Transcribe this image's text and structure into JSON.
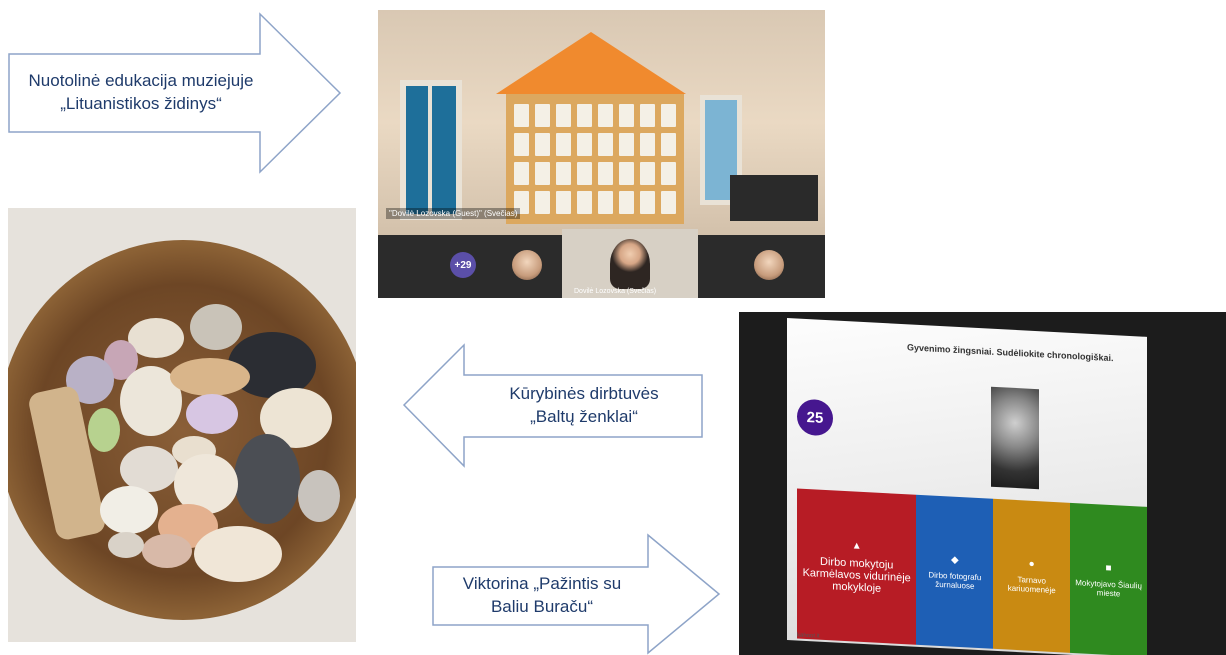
{
  "arrows": {
    "top": {
      "lines": [
        "Nuotolinė edukacija muziejuje",
        "„Lituanistikos židinys“"
      ]
    },
    "middle": {
      "lines": [
        "Kūrybinės dirbtuvės",
        "„Baltų ženklai“"
      ]
    },
    "bottom": {
      "lines": [
        "Viktorina „Pažintis su",
        "Baliu Buraču“"
      ]
    }
  },
  "video_call": {
    "speaker_name": "\"Dovilė Lozovska (Guest)\" (Svečias)",
    "participants_badge": "+29",
    "presenter_name": "Dovilė Lozovska (Svečias)"
  },
  "quiz": {
    "title": "Gyvenimo žingsniai. Sudėliokite chronologiškai.",
    "timer": "25",
    "footer": "kahoot.it",
    "answers": [
      {
        "symbol": "▲",
        "text": "Dirbo mokytoju Karmėlavos vidurinėje mokykloje",
        "color": "#b71c25"
      },
      {
        "symbol": "◆",
        "text": "Dirbo fotografu žurnaluose",
        "color": "#1e5fb5"
      },
      {
        "symbol": "●",
        "text": "Tarnavo kariuomenėje",
        "color": "#c98a12"
      },
      {
        "symbol": "■",
        "text": "Mokytojavo Šiaulių mieste",
        "color": "#2f8a1f"
      }
    ]
  },
  "colors": {
    "arrow_fill": "#ffffff",
    "arrow_stroke": "#8ea4c8",
    "arrow_text": "#1f3b6b",
    "kahoot_purple": "#46178f"
  }
}
